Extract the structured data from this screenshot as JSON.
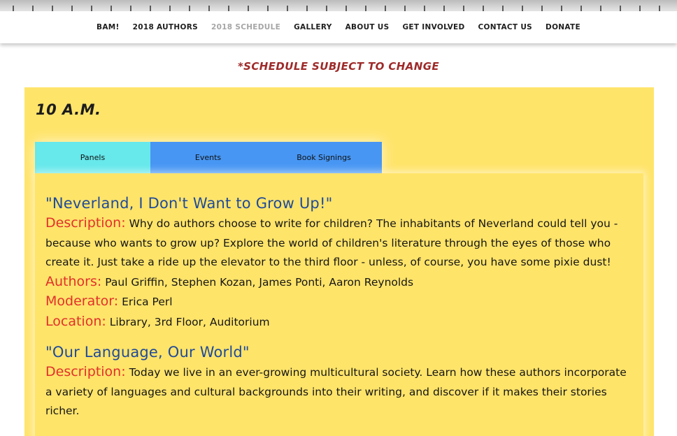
{
  "nav": {
    "items": [
      {
        "label": "BAM!",
        "active": false
      },
      {
        "label": "2018 AUTHORS",
        "active": false
      },
      {
        "label": "2018 SCHEDULE",
        "active": true
      },
      {
        "label": "GALLERY",
        "active": false
      },
      {
        "label": "ABOUT US",
        "active": false
      },
      {
        "label": "GET INVOLVED",
        "active": false
      },
      {
        "label": "CONTACT US",
        "active": false
      },
      {
        "label": "DONATE",
        "active": false
      }
    ]
  },
  "notice": "*SCHEDULE SUBJECT TO CHANGE",
  "schedule": {
    "time": "10 A.M.",
    "tabs": [
      {
        "label": "Panels",
        "active": true
      },
      {
        "label": "Events",
        "active": false
      },
      {
        "label": "Book Signings",
        "active": false
      }
    ],
    "panels": [
      {
        "title": "\"Neverland, I Don't Want to Grow Up!\"",
        "description_label": "Description:",
        "description": "Why do authors choose to write for children? The inhabitants of Neverland could tell you - because who wants to grow up? Explore the world of children's literature through the eyes of those who create it. Just take a ride up the elevator to the third floor - unless, of course, you have some pixie dust!",
        "authors_label": "Authors:",
        "authors": "Paul Griffin, Stephen Kozan, James Ponti, Aaron Reynolds",
        "moderator_label": "Moderator:",
        "moderator": "Erica Perl",
        "location_label": "Location:",
        "location": "Library, 3rd Floor, Auditorium"
      },
      {
        "title": "\"Our Language, Our World\"",
        "description_label": "Description:",
        "description": "Today we live in an ever-growing multicultural society. Learn how these authors incorporate a variety of languages and cultural backgrounds into their writing, and discover if it makes their stories richer."
      }
    ]
  },
  "colors": {
    "box_background": "#ffe46a",
    "tab_active": "#67e8eb",
    "tab_inactive": "#4796f3",
    "title_blue": "#1f4a99",
    "label_red": "#e2302b",
    "notice_red": "#9e2a2a"
  }
}
